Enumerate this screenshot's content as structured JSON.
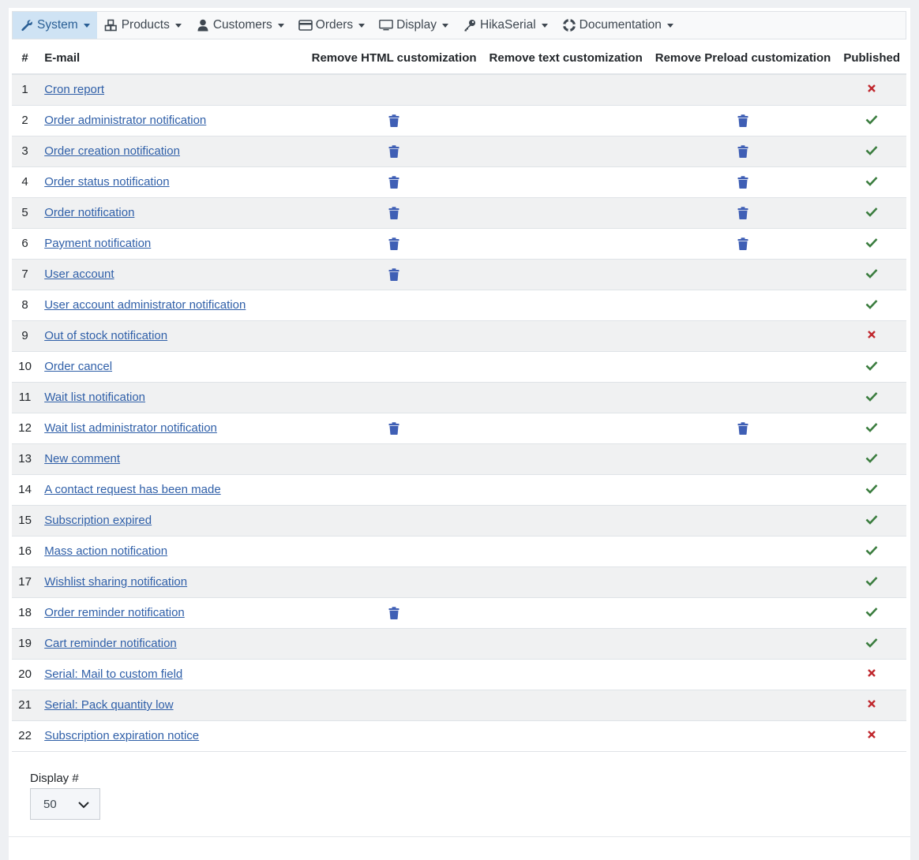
{
  "menu": [
    {
      "label": "System",
      "icon": "wrench-icon",
      "active": true
    },
    {
      "label": "Products",
      "icon": "cubes-icon"
    },
    {
      "label": "Customers",
      "icon": "user-icon"
    },
    {
      "label": "Orders",
      "icon": "credit-card-icon"
    },
    {
      "label": "Display",
      "icon": "monitor-icon"
    },
    {
      "label": "HikaSerial",
      "icon": "key-icon"
    },
    {
      "label": "Documentation",
      "icon": "lifebuoy-icon"
    }
  ],
  "table": {
    "headers": [
      "#",
      "E-mail",
      "Remove HTML customization",
      "Remove text customization",
      "Remove Preload customization",
      "Published"
    ],
    "rows": [
      {
        "num": "1",
        "email": "Cron report",
        "html": false,
        "text": false,
        "preload": false,
        "published": false
      },
      {
        "num": "2",
        "email": "Order administrator notification",
        "html": true,
        "text": false,
        "preload": true,
        "published": true
      },
      {
        "num": "3",
        "email": "Order creation notification",
        "html": true,
        "text": false,
        "preload": true,
        "published": true
      },
      {
        "num": "4",
        "email": "Order status notification",
        "html": true,
        "text": false,
        "preload": true,
        "published": true
      },
      {
        "num": "5",
        "email": "Order notification",
        "html": true,
        "text": false,
        "preload": true,
        "published": true
      },
      {
        "num": "6",
        "email": "Payment notification",
        "html": true,
        "text": false,
        "preload": true,
        "published": true
      },
      {
        "num": "7",
        "email": "User account",
        "html": true,
        "text": false,
        "preload": false,
        "published": true
      },
      {
        "num": "8",
        "email": "User account administrator notification",
        "html": false,
        "text": false,
        "preload": false,
        "published": true
      },
      {
        "num": "9",
        "email": "Out of stock notification",
        "html": false,
        "text": false,
        "preload": false,
        "published": false
      },
      {
        "num": "10",
        "email": "Order cancel",
        "html": false,
        "text": false,
        "preload": false,
        "published": true
      },
      {
        "num": "11",
        "email": "Wait list notification",
        "html": false,
        "text": false,
        "preload": false,
        "published": true
      },
      {
        "num": "12",
        "email": "Wait list administrator notification",
        "html": true,
        "text": false,
        "preload": true,
        "published": true
      },
      {
        "num": "13",
        "email": "New comment",
        "html": false,
        "text": false,
        "preload": false,
        "published": true
      },
      {
        "num": "14",
        "email": "A contact request has been made",
        "html": false,
        "text": false,
        "preload": false,
        "published": true
      },
      {
        "num": "15",
        "email": "Subscription expired",
        "html": false,
        "text": false,
        "preload": false,
        "published": true
      },
      {
        "num": "16",
        "email": "Mass action notification",
        "html": false,
        "text": false,
        "preload": false,
        "published": true
      },
      {
        "num": "17",
        "email": "Wishlist sharing notification",
        "html": false,
        "text": false,
        "preload": false,
        "published": true
      },
      {
        "num": "18",
        "email": "Order reminder notification",
        "html": true,
        "text": false,
        "preload": false,
        "published": true
      },
      {
        "num": "19",
        "email": "Cart reminder notification",
        "html": false,
        "text": false,
        "preload": false,
        "published": true
      },
      {
        "num": "20",
        "email": "Serial: Mail to custom field",
        "html": false,
        "text": false,
        "preload": false,
        "published": false
      },
      {
        "num": "21",
        "email": "Serial: Pack quantity low",
        "html": false,
        "text": false,
        "preload": false,
        "published": false
      },
      {
        "num": "22",
        "email": "Subscription expiration notice",
        "html": false,
        "text": false,
        "preload": false,
        "published": false
      }
    ]
  },
  "pager": {
    "label": "Display #",
    "value": "50"
  },
  "colors": {
    "link": "#2f5fa8",
    "trash": "#3f5fb5",
    "published": "#3b7d3f",
    "unpublished": "#c0272d",
    "active_menu_bg": "#cfe3f4"
  }
}
